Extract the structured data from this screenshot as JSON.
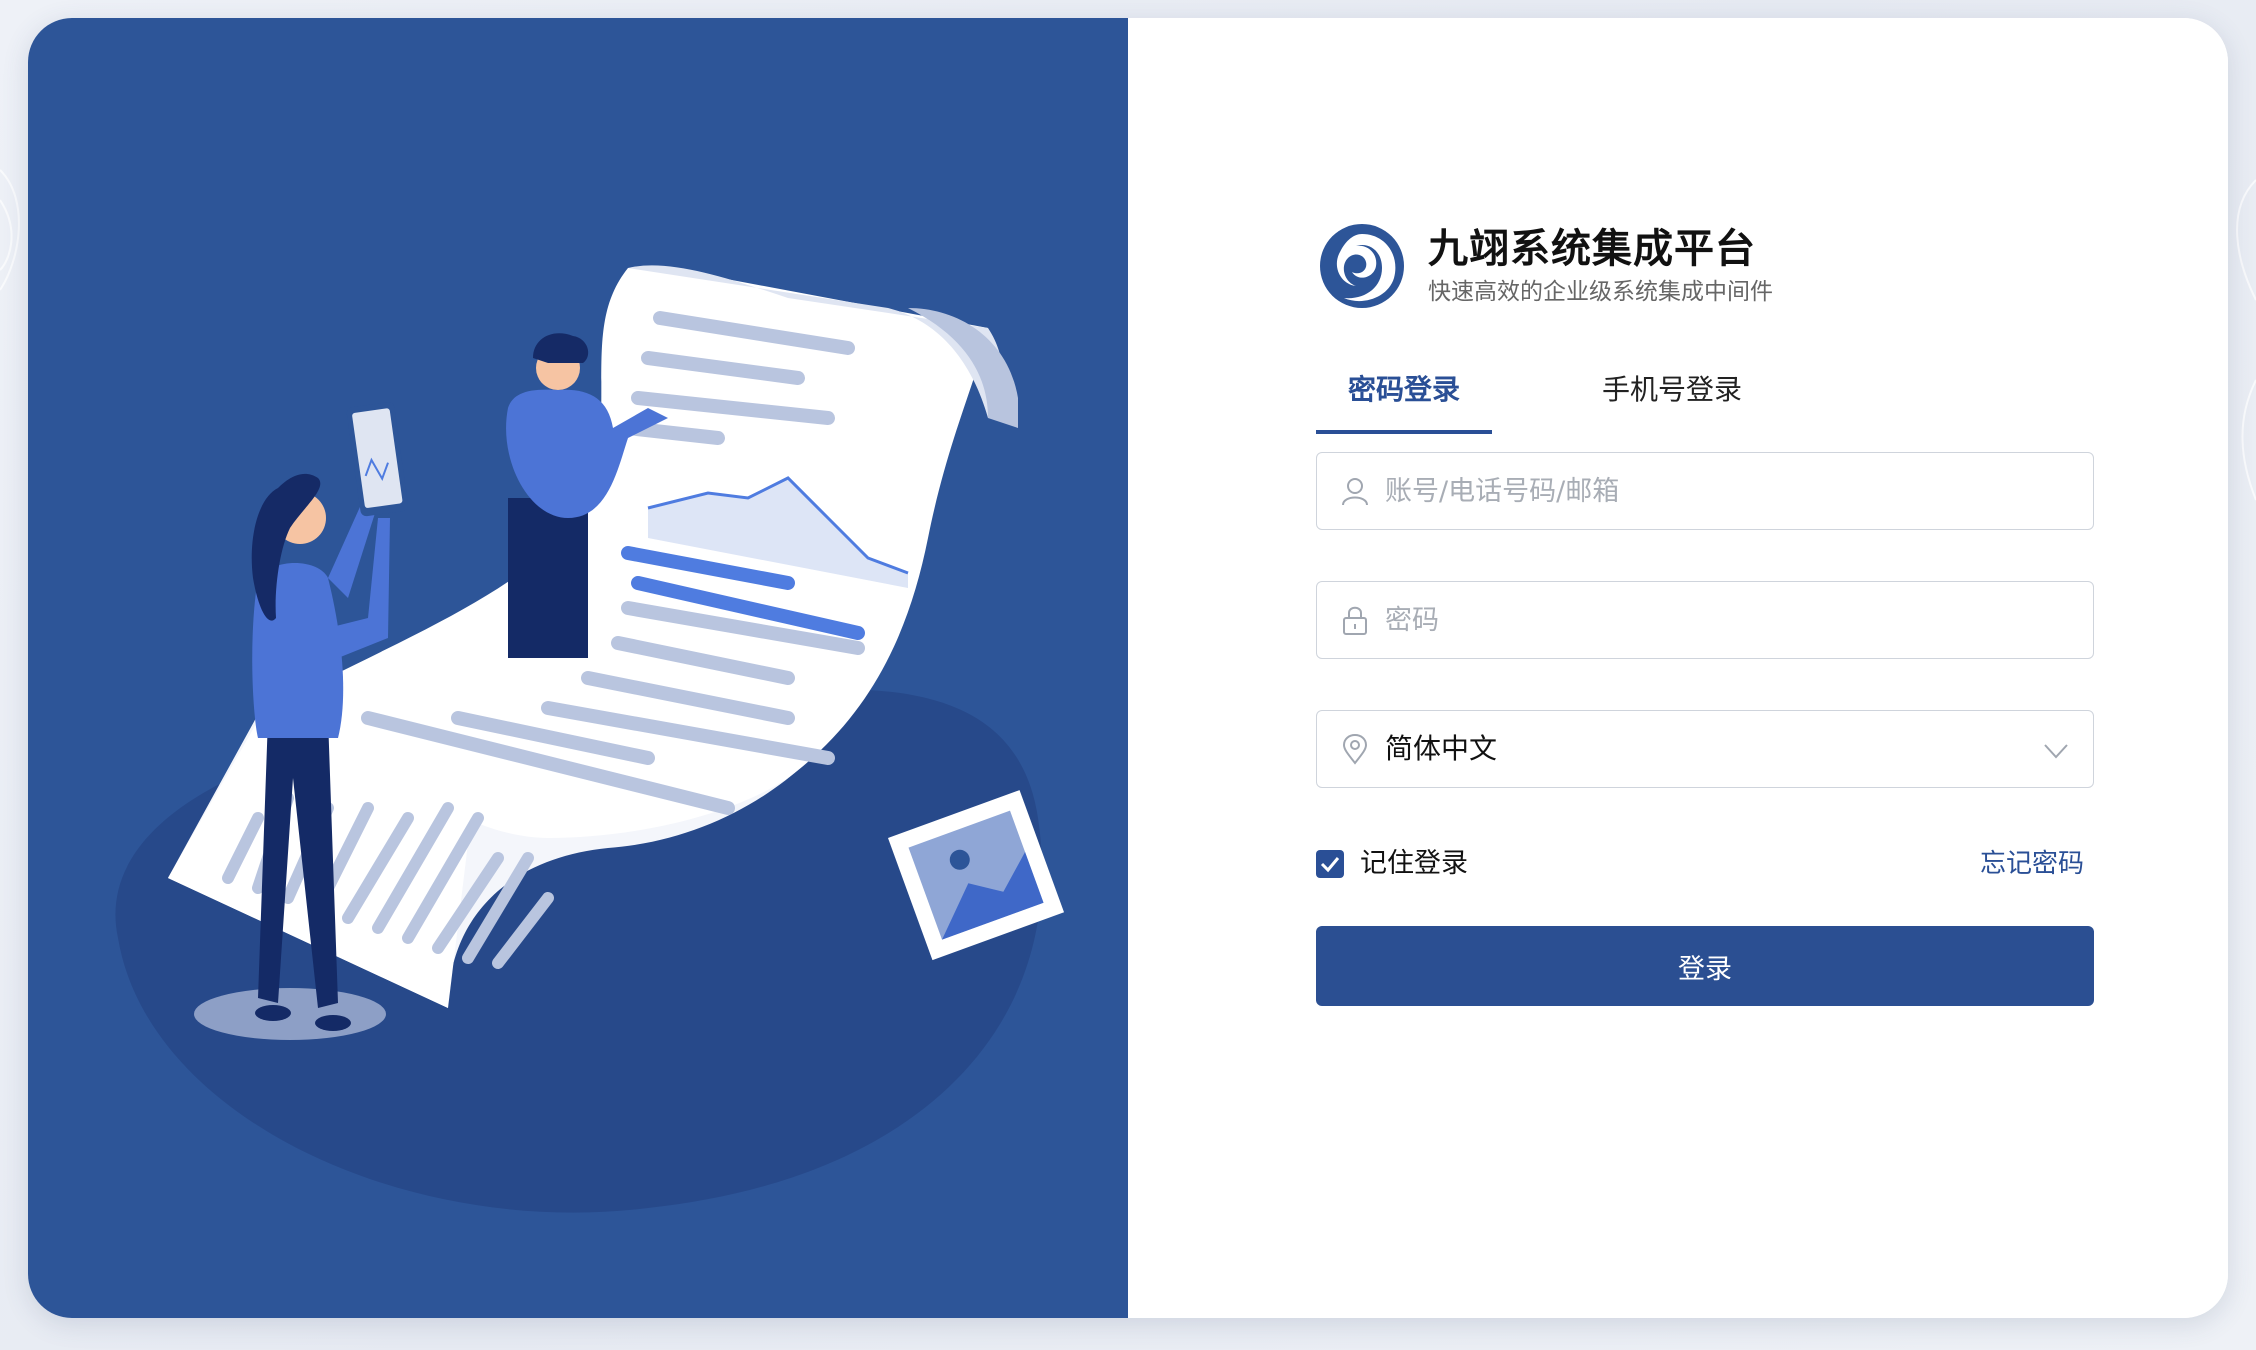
{
  "brand": {
    "title": "九翊系统集成平台",
    "subtitle": "快速高效的企业级系统集成中间件",
    "logo_icon": "swirl-logo-icon"
  },
  "tabs": [
    {
      "label": "密码登录",
      "active": true
    },
    {
      "label": "手机号登录",
      "active": false
    }
  ],
  "form": {
    "account": {
      "placeholder": "账号/电话号码/邮箱",
      "icon": "user-icon",
      "value": ""
    },
    "password": {
      "placeholder": "密码",
      "icon": "lock-icon",
      "value": ""
    },
    "language": {
      "value": "简体中文",
      "icon": "location-pin-icon",
      "dropdown_icon": "chevron-down-icon"
    },
    "remember": {
      "label": "记住登录",
      "checked": true
    },
    "forgot_label": "忘记密码",
    "submit_label": "登录"
  },
  "colors": {
    "primary": "#2b4f92",
    "left_panel": "#2d5598",
    "accent_blue": "#4f7ce0"
  }
}
